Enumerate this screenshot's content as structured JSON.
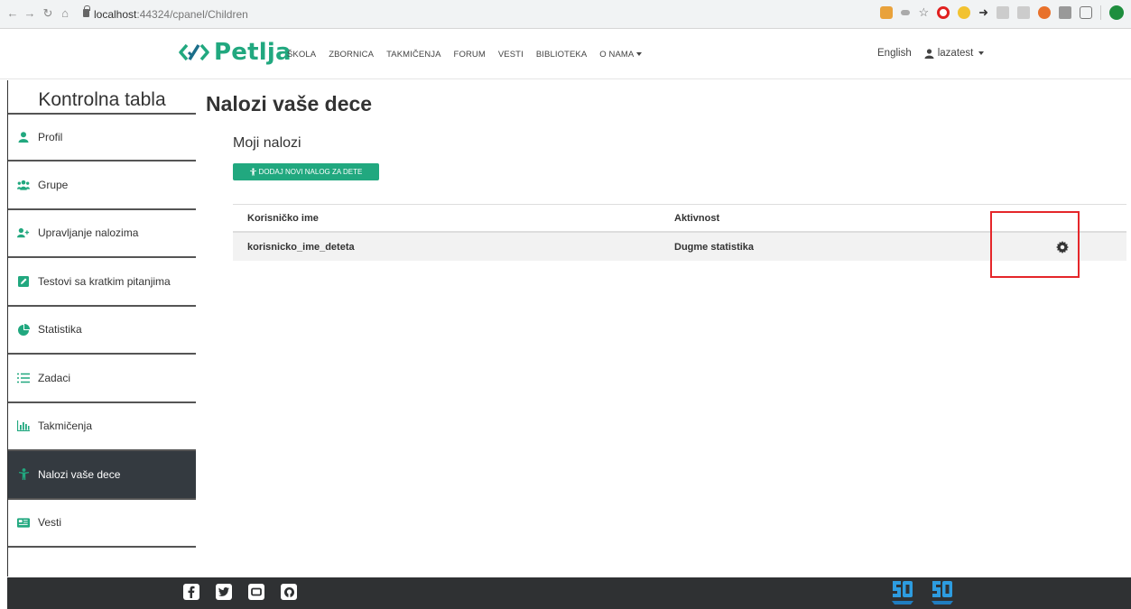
{
  "browser": {
    "url_host": "localhost",
    "url_rest": ":44324/cpanel/Children"
  },
  "header": {
    "logo_text": "Petlja",
    "nav": [
      "ŠKOLA",
      "ZBORNICA",
      "TAKMIČENJA",
      "FORUM",
      "VESTI",
      "BIBLIOTEKA",
      "O NAMA"
    ],
    "language": "English",
    "username": "lazatest"
  },
  "sidebar": {
    "title": "Kontrolna tabla",
    "items": [
      {
        "label": "Profil",
        "icon": "user-icon"
      },
      {
        "label": "Grupe",
        "icon": "users-icon"
      },
      {
        "label": "Upravljanje nalozima",
        "icon": "user-plus-icon"
      },
      {
        "label": "Testovi sa kratkim pitanjima",
        "icon": "edit-icon"
      },
      {
        "label": "Statistika",
        "icon": "pie-chart-icon"
      },
      {
        "label": "Zadaci",
        "icon": "list-icon"
      },
      {
        "label": "Takmičenja",
        "icon": "bar-chart-icon"
      },
      {
        "label": "Nalozi vaše dece",
        "icon": "child-icon",
        "active": true
      },
      {
        "label": "Vesti",
        "icon": "newspaper-icon"
      }
    ]
  },
  "main": {
    "title": "Nalozi vaše dece",
    "section_title": "Moji nalozi",
    "add_button": "DODAJ NOVI NALOG ZA DETE",
    "table": {
      "headers": [
        "Korisničko ime",
        "Aktivnost"
      ],
      "rows": [
        {
          "username": "korisnicko_ime_deteta",
          "activity": "Dugme statistika"
        }
      ]
    }
  },
  "colors": {
    "accent": "#21a87f",
    "sidebar_active": "#343a40",
    "highlight": "#e5262a",
    "footer": "#2f3133"
  }
}
